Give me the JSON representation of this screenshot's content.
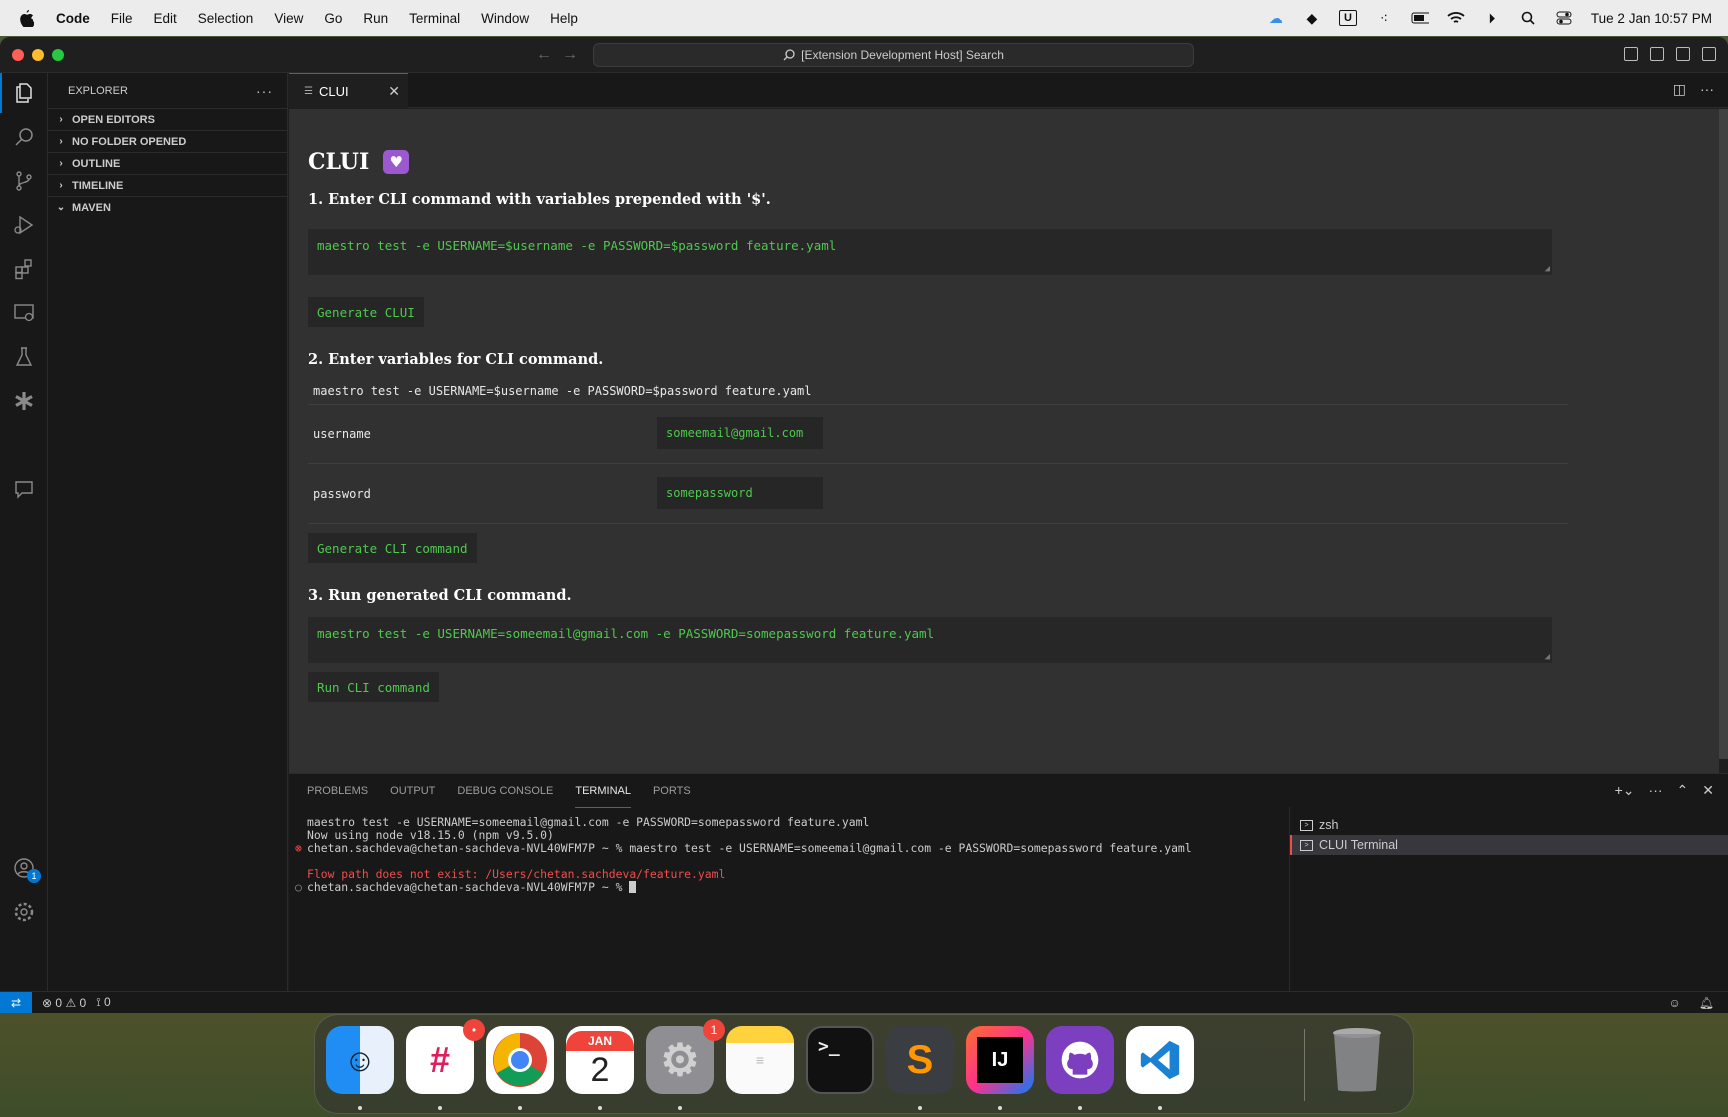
{
  "menubar": {
    "items": [
      "Code",
      "File",
      "Edit",
      "Selection",
      "View",
      "Go",
      "Run",
      "Terminal",
      "Window",
      "Help"
    ],
    "clock": "Tue 2 Jan  10:57 PM",
    "tray_icons": [
      "cloud-icon",
      "cube-icon",
      "u-icon",
      "display-icon",
      "battery-icon",
      "wifi-icon",
      "play-icon",
      "search-icon",
      "control-center-icon"
    ]
  },
  "window": {
    "command_center": "[Extension Development Host] Search"
  },
  "explorer": {
    "title": "EXPLORER",
    "sections": [
      "OPEN EDITORS",
      "NO FOLDER OPENED",
      "OUTLINE",
      "TIMELINE",
      "MAVEN"
    ]
  },
  "activitybar": {
    "accounts_badge": "1"
  },
  "editor": {
    "tab_label": "CLUI"
  },
  "webview": {
    "title": "CLUI",
    "step1": "1. Enter CLI command with variables prepended with '$'.",
    "command_template": "maestro test -e USERNAME=$username -e PASSWORD=$password feature.yaml",
    "generate_clui_label": "Generate CLUI",
    "step2": "2. Enter variables for CLI command.",
    "command_echo": "maestro test -e USERNAME=$username -e PASSWORD=$password feature.yaml",
    "variables": [
      {
        "name": "username",
        "value": "someemail@gmail.com"
      },
      {
        "name": "password",
        "value": "somepassword"
      }
    ],
    "generate_cli_label": "Generate CLI command",
    "step3": "3. Run generated CLI command.",
    "generated_command": "maestro test -e USERNAME=someemail@gmail.com -e PASSWORD=somepassword feature.yaml",
    "run_label": "Run CLI command"
  },
  "panel": {
    "tabs": [
      "PROBLEMS",
      "OUTPUT",
      "DEBUG CONSOLE",
      "TERMINAL",
      "PORTS"
    ],
    "terminal_lines": [
      "maestro test -e USERNAME=someemail@gmail.com -e PASSWORD=somepassword feature.yaml",
      "Now using node v18.15.0 (npm v9.5.0)",
      "chetan.sachdeva@chetan-sachdeva-NVL40WFM7P ~ % maestro test -e USERNAME=someemail@gmail.com -e PASSWORD=somepassword feature.yaml",
      "Flow path does not exist: /Users/chetan.sachdeva/feature.yaml",
      "chetan.sachdeva@chetan-sachdeva-NVL40WFM7P ~ % "
    ],
    "terminals": [
      "zsh",
      "CLUI Terminal"
    ]
  },
  "statusbar": {
    "errors": "0",
    "warnings": "0",
    "ports": "0"
  },
  "dock": {
    "calendar_month": "JAN",
    "calendar_day": "2",
    "settings_badge": "1",
    "slack_badge": "•"
  },
  "colors": {
    "accent": "#0078d4",
    "terminal_green": "#4ec94e",
    "error": "#f14c4c"
  }
}
